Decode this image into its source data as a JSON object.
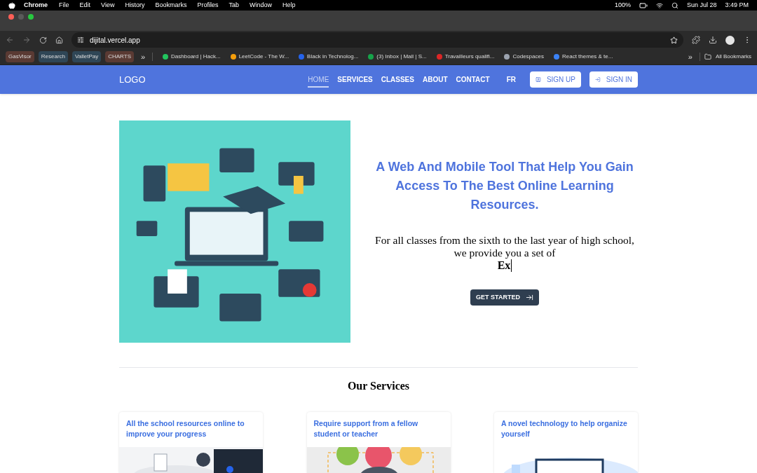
{
  "menu_bar": {
    "app": "Chrome",
    "items": [
      "File",
      "Edit",
      "View",
      "History",
      "Bookmarks",
      "Profiles",
      "Tab",
      "Window",
      "Help"
    ],
    "battery": "100%",
    "date": "Sun Jul 28",
    "time": "3:49 PM"
  },
  "browser": {
    "url": "dijital.vercel.app",
    "bookmark_tags": [
      {
        "label": "GasVisor",
        "color": "#5a3a33"
      },
      {
        "label": "Research",
        "color": "#2f4656"
      },
      {
        "label": "ValletPay",
        "color": "#2f4656"
      },
      {
        "label": "CHARTS",
        "color": "#5a3a33"
      }
    ],
    "more_tags": "»",
    "bookmarks": [
      "Dashboard | Hack...",
      "LeetCode - The W...",
      "Black in Technolog...",
      "(3) Inbox | Mail | S...",
      "Travailleurs qualifi...",
      "Codespaces",
      "React themes & te..."
    ],
    "more_bookmarks": "»",
    "all_bookmarks": "All Bookmarks"
  },
  "navbar": {
    "logo": "LOGO",
    "links": [
      {
        "label": "HOME",
        "selected": true
      },
      {
        "label": "SERVICES",
        "selected": false
      },
      {
        "label": "CLASSES",
        "selected": false
      },
      {
        "label": "ABOUT",
        "selected": false
      },
      {
        "label": "CONTACT",
        "selected": false
      }
    ],
    "language": "FR",
    "sign_up": "SIGN UP",
    "sign_in": "SIGN IN"
  },
  "hero": {
    "title": "A Web And Mobile Tool That Help You Gain Access To The Best Online Learning Resources.",
    "text": "For all classes from the sixth to the last year of high school, we provide you a set of",
    "typed": "Ex",
    "button": "GET STARTED"
  },
  "services": {
    "title": "Our Services",
    "cards": [
      {
        "title": "All the school resources online to improve your progress"
      },
      {
        "title": "Require support from a fellow student or teacher"
      },
      {
        "title": "A novel technology to help organize yourself"
      }
    ]
  }
}
